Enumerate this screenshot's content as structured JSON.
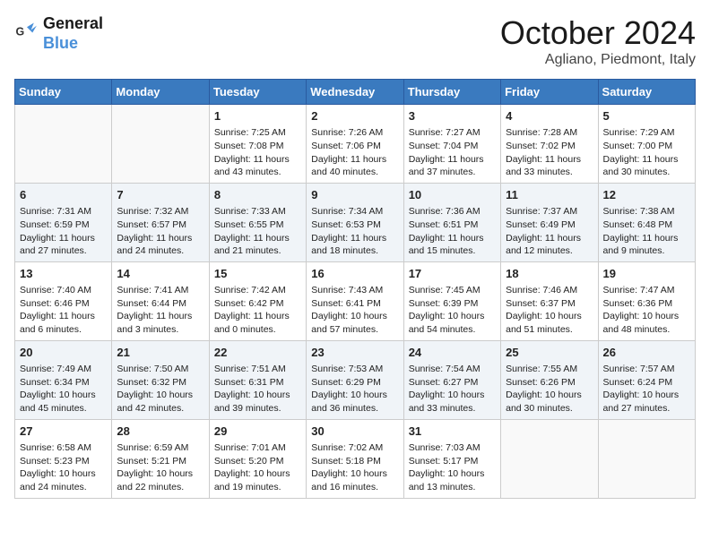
{
  "header": {
    "logo_line1": "General",
    "logo_line2": "Blue",
    "title": "October 2024",
    "location": "Agliano, Piedmont, Italy"
  },
  "weekdays": [
    "Sunday",
    "Monday",
    "Tuesday",
    "Wednesday",
    "Thursday",
    "Friday",
    "Saturday"
  ],
  "weeks": [
    [
      {
        "day": "",
        "info": ""
      },
      {
        "day": "",
        "info": ""
      },
      {
        "day": "1",
        "info": "Sunrise: 7:25 AM\nSunset: 7:08 PM\nDaylight: 11 hours and 43 minutes."
      },
      {
        "day": "2",
        "info": "Sunrise: 7:26 AM\nSunset: 7:06 PM\nDaylight: 11 hours and 40 minutes."
      },
      {
        "day": "3",
        "info": "Sunrise: 7:27 AM\nSunset: 7:04 PM\nDaylight: 11 hours and 37 minutes."
      },
      {
        "day": "4",
        "info": "Sunrise: 7:28 AM\nSunset: 7:02 PM\nDaylight: 11 hours and 33 minutes."
      },
      {
        "day": "5",
        "info": "Sunrise: 7:29 AM\nSunset: 7:00 PM\nDaylight: 11 hours and 30 minutes."
      }
    ],
    [
      {
        "day": "6",
        "info": "Sunrise: 7:31 AM\nSunset: 6:59 PM\nDaylight: 11 hours and 27 minutes."
      },
      {
        "day": "7",
        "info": "Sunrise: 7:32 AM\nSunset: 6:57 PM\nDaylight: 11 hours and 24 minutes."
      },
      {
        "day": "8",
        "info": "Sunrise: 7:33 AM\nSunset: 6:55 PM\nDaylight: 11 hours and 21 minutes."
      },
      {
        "day": "9",
        "info": "Sunrise: 7:34 AM\nSunset: 6:53 PM\nDaylight: 11 hours and 18 minutes."
      },
      {
        "day": "10",
        "info": "Sunrise: 7:36 AM\nSunset: 6:51 PM\nDaylight: 11 hours and 15 minutes."
      },
      {
        "day": "11",
        "info": "Sunrise: 7:37 AM\nSunset: 6:49 PM\nDaylight: 11 hours and 12 minutes."
      },
      {
        "day": "12",
        "info": "Sunrise: 7:38 AM\nSunset: 6:48 PM\nDaylight: 11 hours and 9 minutes."
      }
    ],
    [
      {
        "day": "13",
        "info": "Sunrise: 7:40 AM\nSunset: 6:46 PM\nDaylight: 11 hours and 6 minutes."
      },
      {
        "day": "14",
        "info": "Sunrise: 7:41 AM\nSunset: 6:44 PM\nDaylight: 11 hours and 3 minutes."
      },
      {
        "day": "15",
        "info": "Sunrise: 7:42 AM\nSunset: 6:42 PM\nDaylight: 11 hours and 0 minutes."
      },
      {
        "day": "16",
        "info": "Sunrise: 7:43 AM\nSunset: 6:41 PM\nDaylight: 10 hours and 57 minutes."
      },
      {
        "day": "17",
        "info": "Sunrise: 7:45 AM\nSunset: 6:39 PM\nDaylight: 10 hours and 54 minutes."
      },
      {
        "day": "18",
        "info": "Sunrise: 7:46 AM\nSunset: 6:37 PM\nDaylight: 10 hours and 51 minutes."
      },
      {
        "day": "19",
        "info": "Sunrise: 7:47 AM\nSunset: 6:36 PM\nDaylight: 10 hours and 48 minutes."
      }
    ],
    [
      {
        "day": "20",
        "info": "Sunrise: 7:49 AM\nSunset: 6:34 PM\nDaylight: 10 hours and 45 minutes."
      },
      {
        "day": "21",
        "info": "Sunrise: 7:50 AM\nSunset: 6:32 PM\nDaylight: 10 hours and 42 minutes."
      },
      {
        "day": "22",
        "info": "Sunrise: 7:51 AM\nSunset: 6:31 PM\nDaylight: 10 hours and 39 minutes."
      },
      {
        "day": "23",
        "info": "Sunrise: 7:53 AM\nSunset: 6:29 PM\nDaylight: 10 hours and 36 minutes."
      },
      {
        "day": "24",
        "info": "Sunrise: 7:54 AM\nSunset: 6:27 PM\nDaylight: 10 hours and 33 minutes."
      },
      {
        "day": "25",
        "info": "Sunrise: 7:55 AM\nSunset: 6:26 PM\nDaylight: 10 hours and 30 minutes."
      },
      {
        "day": "26",
        "info": "Sunrise: 7:57 AM\nSunset: 6:24 PM\nDaylight: 10 hours and 27 minutes."
      }
    ],
    [
      {
        "day": "27",
        "info": "Sunrise: 6:58 AM\nSunset: 5:23 PM\nDaylight: 10 hours and 24 minutes."
      },
      {
        "day": "28",
        "info": "Sunrise: 6:59 AM\nSunset: 5:21 PM\nDaylight: 10 hours and 22 minutes."
      },
      {
        "day": "29",
        "info": "Sunrise: 7:01 AM\nSunset: 5:20 PM\nDaylight: 10 hours and 19 minutes."
      },
      {
        "day": "30",
        "info": "Sunrise: 7:02 AM\nSunset: 5:18 PM\nDaylight: 10 hours and 16 minutes."
      },
      {
        "day": "31",
        "info": "Sunrise: 7:03 AM\nSunset: 5:17 PM\nDaylight: 10 hours and 13 minutes."
      },
      {
        "day": "",
        "info": ""
      },
      {
        "day": "",
        "info": ""
      }
    ]
  ]
}
